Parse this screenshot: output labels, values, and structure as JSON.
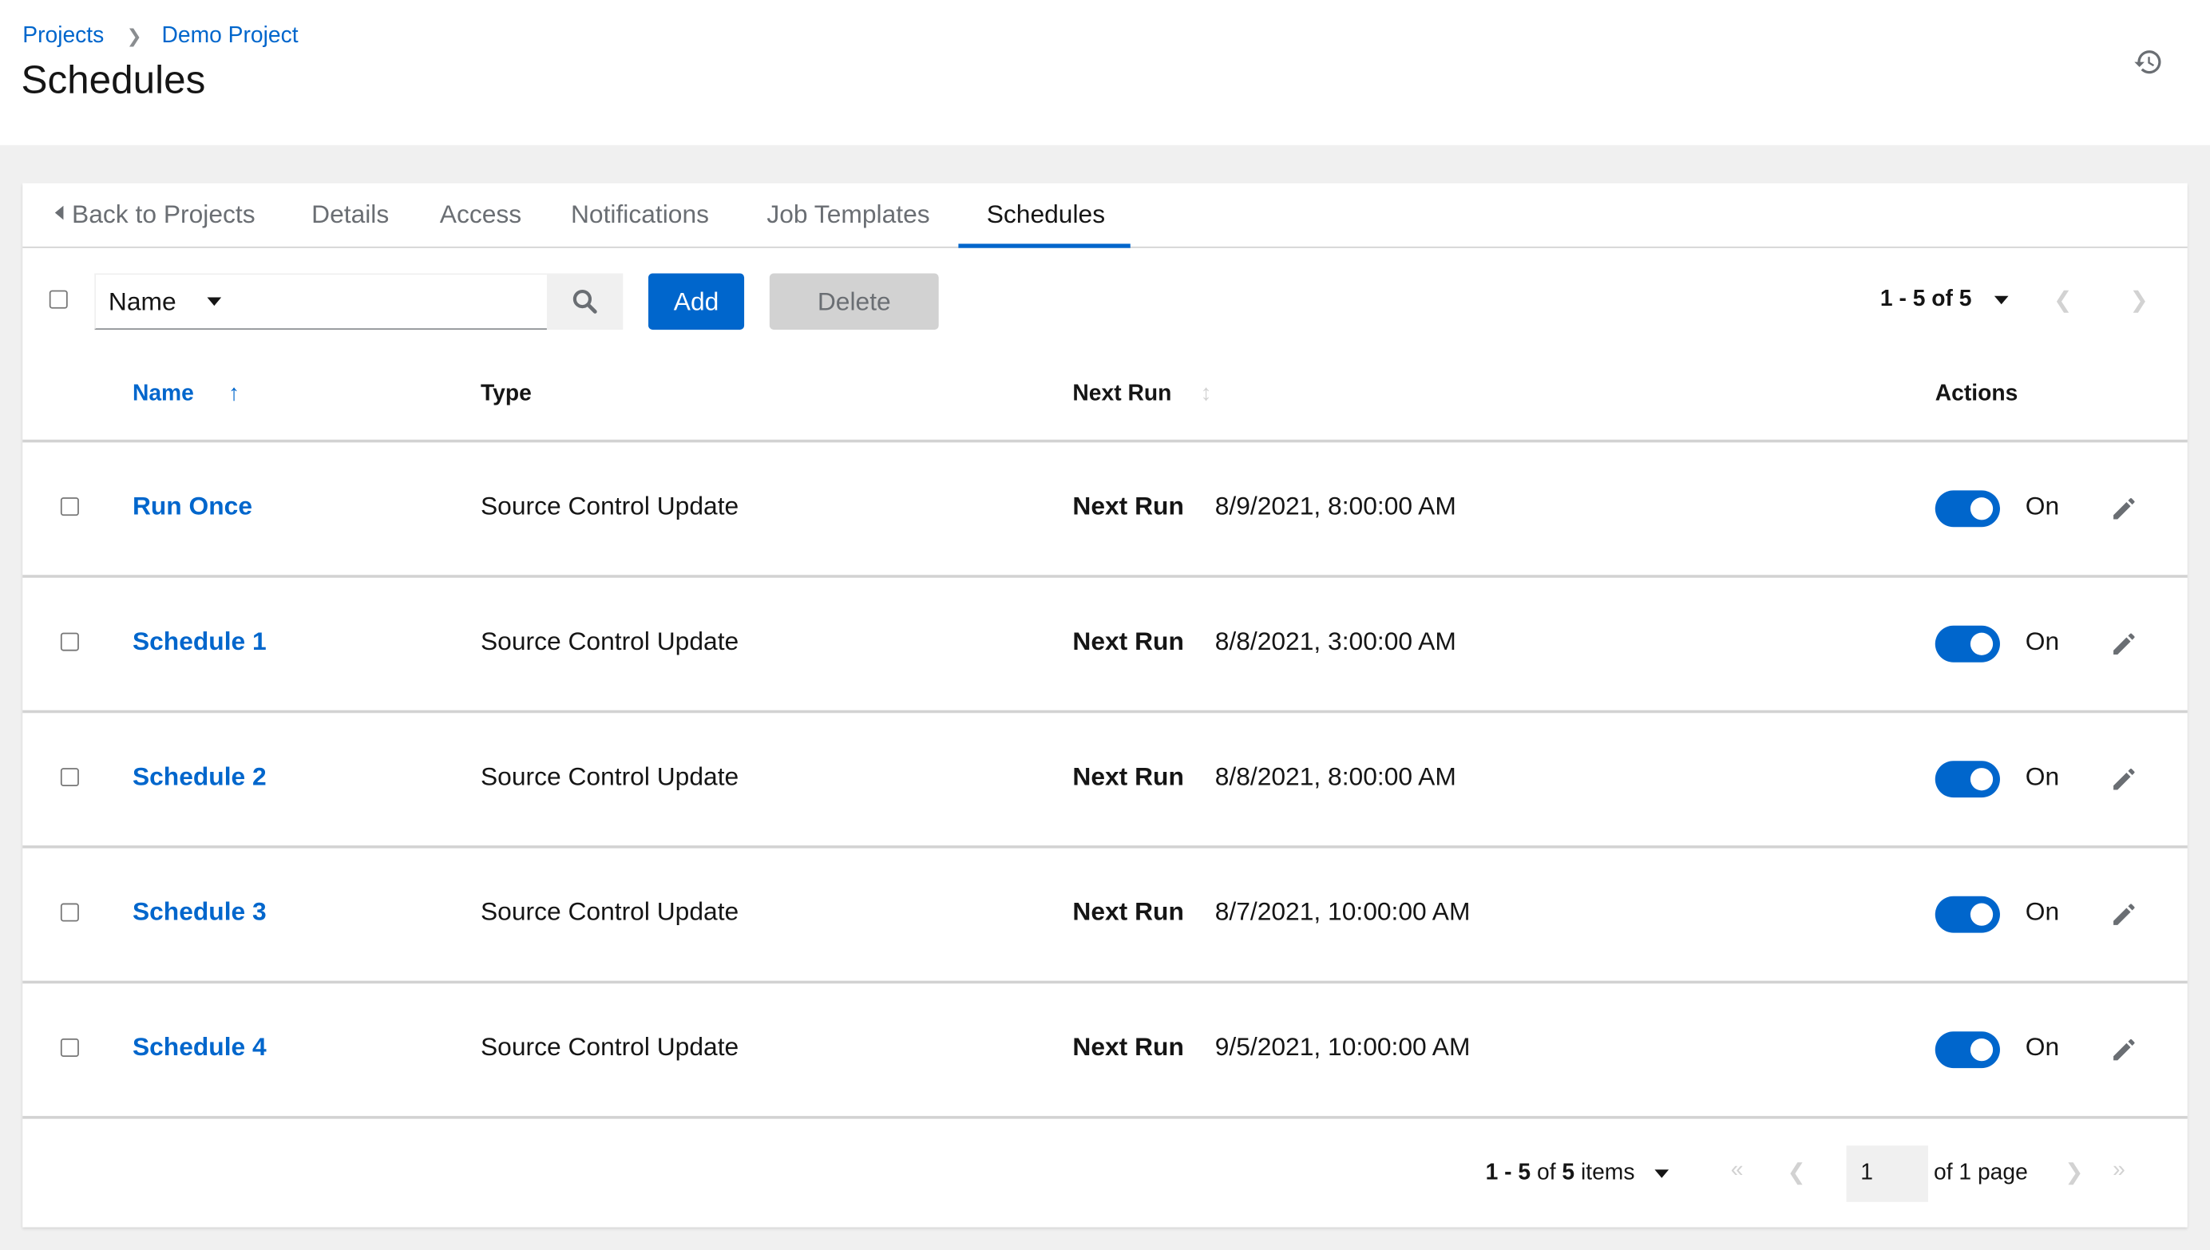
{
  "header": {
    "breadcrumb": [
      {
        "label": "Projects"
      },
      {
        "label": "Demo Project"
      }
    ],
    "title": "Schedules",
    "history_icon": "history-icon"
  },
  "tabs": [
    {
      "label": "Back to Projects",
      "icon": "caret-left-icon"
    },
    {
      "label": "Details"
    },
    {
      "label": "Access"
    },
    {
      "label": "Notifications"
    },
    {
      "label": "Job Templates"
    },
    {
      "label": "Schedules",
      "active": true
    }
  ],
  "toolbar": {
    "filter_field": "Name",
    "search_value": "",
    "search_placeholder": "",
    "add_label": "Add",
    "delete_label": "Delete",
    "pagination_text": "1 - 5 of 5"
  },
  "table": {
    "columns": {
      "name": "Name",
      "type": "Type",
      "next_run": "Next Run",
      "actions": "Actions"
    },
    "rows": [
      {
        "name": "Run Once",
        "type": "Source Control Update",
        "next_run_label": "Next Run",
        "next_run": "8/9/2021, 8:00:00 AM",
        "enabled": true,
        "toggle_label": "On"
      },
      {
        "name": "Schedule 1",
        "type": "Source Control Update",
        "next_run_label": "Next Run",
        "next_run": "8/8/2021, 3:00:00 AM",
        "enabled": true,
        "toggle_label": "On"
      },
      {
        "name": "Schedule 2",
        "type": "Source Control Update",
        "next_run_label": "Next Run",
        "next_run": "8/8/2021, 8:00:00 AM",
        "enabled": true,
        "toggle_label": "On"
      },
      {
        "name": "Schedule 3",
        "type": "Source Control Update",
        "next_run_label": "Next Run",
        "next_run": "8/7/2021, 10:00:00 AM",
        "enabled": true,
        "toggle_label": "On"
      },
      {
        "name": "Schedule 4",
        "type": "Source Control Update",
        "next_run_label": "Next Run",
        "next_run": "9/5/2021, 10:00:00 AM",
        "enabled": true,
        "toggle_label": "On"
      }
    ]
  },
  "footer": {
    "items_text_pre": "1 - 5",
    "items_text_of": " of ",
    "items_text_total": "5",
    "items_text_post": " items",
    "page_value": "1",
    "of_pages": "of 1 page"
  },
  "colors": {
    "accent": "#0066cc",
    "disabled": "#d2d2d2",
    "background": "#f0f0f0"
  }
}
